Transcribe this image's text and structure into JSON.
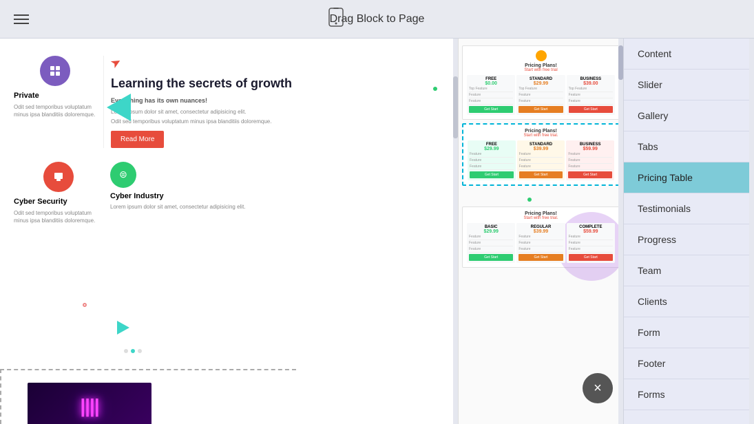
{
  "topbar": {
    "drag_label": "Drag Block to Page",
    "hamburger_title": "Menu"
  },
  "sidebar": {
    "items": [
      {
        "id": "content",
        "label": "Content"
      },
      {
        "id": "slider",
        "label": "Slider"
      },
      {
        "id": "gallery",
        "label": "Gallery"
      },
      {
        "id": "tabs",
        "label": "Tabs"
      },
      {
        "id": "pricing-table",
        "label": "Pricing Table"
      },
      {
        "id": "testimonials",
        "label": "Testimonials"
      },
      {
        "id": "progress",
        "label": "Progress"
      },
      {
        "id": "team",
        "label": "Team"
      },
      {
        "id": "clients",
        "label": "Clients"
      },
      {
        "id": "form",
        "label": "Form"
      },
      {
        "id": "footer",
        "label": "Footer"
      },
      {
        "id": "forms",
        "label": "Forms"
      }
    ]
  },
  "canvas": {
    "features": [
      {
        "icon": "layers",
        "icon_type": "purple",
        "title": "Private",
        "description": "Odit sed temporibus voluptatum minus ipsa blanditiis doloremque."
      },
      {
        "icon": "grid",
        "icon_type": "red",
        "title": "Cyber Security",
        "description": "Odit sed temporibus voluptatum minus ipsa blanditiis doloremque."
      }
    ],
    "learning": {
      "heading": "Learning the secrets of growth",
      "subheading": "Everything has its own nuances!",
      "paragraph1": "Lorem ipsum dolor sit amet, consectetur adipisicing elit.",
      "paragraph2": "Odit sed temporibus voluptatum minus ipsa blanditiis doloremque.",
      "cta_label": "Read More"
    },
    "cyber_industry": {
      "title": "Cyber Industry",
      "description": "Lorem ipsum dolor sit amet, consectetur adipisicing elit."
    },
    "pricing_thumbs": [
      {
        "title": "Pricing Plans!",
        "subtitle": "Start with free trial",
        "plans": [
          {
            "name": "FREE",
            "price": "$0.00",
            "price_color": "green"
          },
          {
            "name": "STANDARD",
            "price": "$29.99",
            "price_color": "orange"
          },
          {
            "name": "BUSINESS",
            "price": "$39.00",
            "price_color": "red"
          }
        ]
      },
      {
        "title": "Pricing Plans!",
        "subtitle": "Start with free trial.",
        "selected": true,
        "plans": [
          {
            "name": "FREE",
            "price": "$29.99",
            "price_color": "green"
          },
          {
            "name": "STANDARD",
            "price": "$39.99",
            "price_color": "orange"
          },
          {
            "name": "BUSINESS",
            "price": "$59.99",
            "price_color": "red"
          }
        ]
      },
      {
        "title": "Pricing Plans!",
        "subtitle": "Start with free trial.",
        "plans": [
          {
            "name": "BASIC",
            "price": "$29.99",
            "price_color": "green"
          },
          {
            "name": "REGULAR",
            "price": "$39.99",
            "price_color": "orange"
          },
          {
            "name": "COMPLETE",
            "price": "$59.99",
            "price_color": "red"
          }
        ]
      }
    ]
  },
  "close_btn_label": "×",
  "icons": {
    "hamburger": "☰",
    "device": "📱",
    "layers": "⊞",
    "grid": "⊟",
    "arrow": "➤",
    "equalizer": "⊜"
  }
}
